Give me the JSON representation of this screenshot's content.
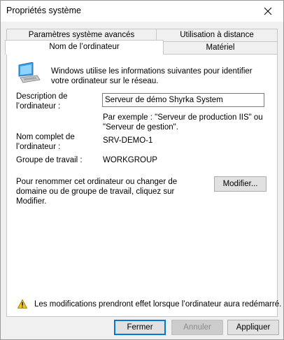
{
  "window": {
    "title": "Propriétés système",
    "close_icon": "close-icon"
  },
  "tabs": {
    "row1": [
      {
        "label": "Paramètres système avancés"
      },
      {
        "label": "Utilisation à distance"
      }
    ],
    "row2": [
      {
        "label": "Nom de l’ordinateur",
        "selected": true
      },
      {
        "label": "Matériel"
      }
    ]
  },
  "panel": {
    "computer_icon": "computer-icon",
    "intro_text": "Windows utilise les informations suivantes pour identifier votre ordinateur sur le réseau.",
    "description": {
      "label": "Description de l’ordinateur :",
      "value": "Serveur de démo Shyrka System",
      "example": "Par exemple : \"Serveur de production IIS\" ou \"Serveur de gestion\"."
    },
    "full_name": {
      "label": "Nom complet de l’ordinateur :",
      "value": "SRV-DEMO-1"
    },
    "workgroup": {
      "label": "Groupe de travail :",
      "value": "WORKGROUP"
    },
    "rename_text": "Pour renommer cet ordinateur ou changer de domaine ou de groupe de travail, cliquez sur Modifier.",
    "modify_button": "Modifier...",
    "warning_icon": "warning-icon",
    "warning_text": "Les modifications prendront effet lorsque l’ordinateur aura redémarré."
  },
  "footer": {
    "ok_button": "Fermer",
    "cancel_button": "Annuler",
    "apply_button": "Appliquer"
  },
  "colors": {
    "accent": "#0078d7",
    "warning": "#f2c811"
  }
}
